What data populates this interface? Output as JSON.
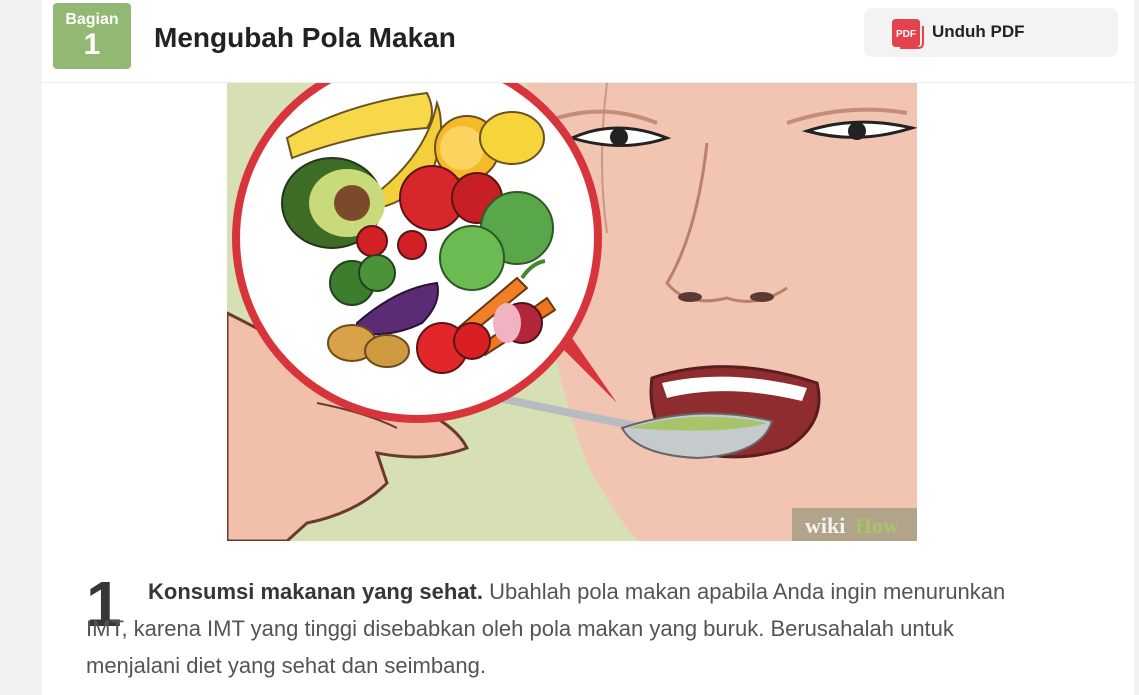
{
  "section": {
    "badge_label": "Bagian",
    "badge_number": "1",
    "title": "Mengubah Pola Makan"
  },
  "download": {
    "icon_text": "PDF",
    "label": "Unduh PDF"
  },
  "illustration": {
    "watermark_a": "wiki",
    "watermark_b": "How"
  },
  "step": {
    "number": "1",
    "lead": "Konsumsi makanan yang sehat.",
    "body": " Ubahlah pola makan apabila Anda ingin menurunkan IMT, karena IMT yang tinggi disebabkan oleh pola makan yang buruk. Berusahalah untuk menjalani diet yang sehat dan seimbang."
  },
  "colors": {
    "badge": "#93b874",
    "pdf_icon": "#e2434d",
    "page_bg": "#f2f2f2"
  }
}
